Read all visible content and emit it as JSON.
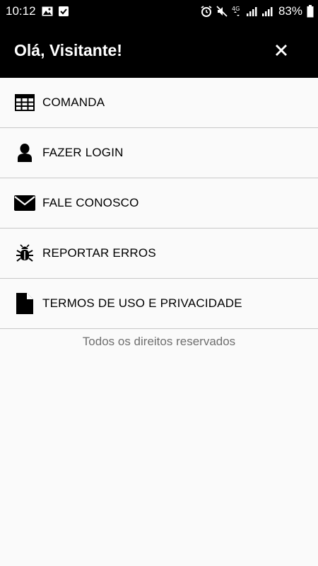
{
  "status_bar": {
    "time": "10:12",
    "battery": "83%",
    "network": "4G",
    "icons_left": [
      "image-icon",
      "check-box-icon"
    ],
    "icons_right": [
      "alarm-icon",
      "mute-icon",
      "network-4g-icon",
      "signal-icon",
      "signal-icon",
      "battery-icon"
    ]
  },
  "header": {
    "title": "Olá, Visitante!",
    "close_icon": "close-icon"
  },
  "menu": {
    "items": [
      {
        "label": "COMANDA",
        "icon": "table-grid-icon"
      },
      {
        "label": "FAZER LOGIN",
        "icon": "person-icon"
      },
      {
        "label": "FALE CONOSCO",
        "icon": "envelope-icon"
      },
      {
        "label": "REPORTAR ERROS",
        "icon": "bug-icon"
      },
      {
        "label": "TERMOS DE USO E PRIVACIDADE",
        "icon": "document-icon"
      }
    ]
  },
  "footer": {
    "text": "Todos os direitos reservados"
  },
  "colors": {
    "header_bg": "#000000",
    "page_bg": "#fafafa",
    "divider": "#c8c8c8",
    "footer_text": "#6f6f6f"
  }
}
